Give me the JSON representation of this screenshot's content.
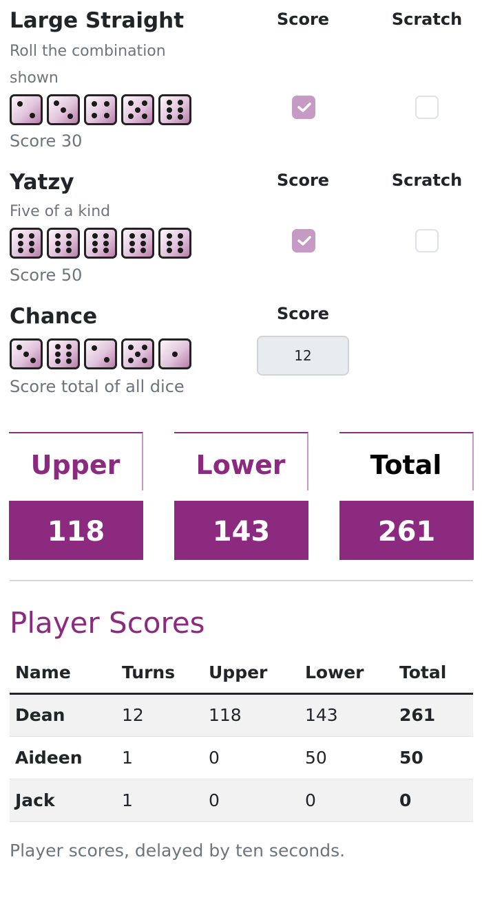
{
  "categories": [
    {
      "title": "Large Straight",
      "description": "Roll the combination shown",
      "dice": [
        2,
        3,
        4,
        5,
        6
      ],
      "score_line": "Score 30",
      "score_header": "Score",
      "scratch_header": "Scratch",
      "score_checked": true,
      "scratch_checked": false
    },
    {
      "title": "Yatzy",
      "description": "Five of a kind",
      "dice": [
        6,
        6,
        6,
        6,
        6
      ],
      "score_line": "Score 50",
      "score_header": "Score",
      "scratch_header": "Scratch",
      "score_checked": true,
      "scratch_checked": false
    },
    {
      "title": "Chance",
      "description": "Score total of all dice",
      "dice": [
        3,
        6,
        2,
        5,
        1
      ],
      "score_header": "Score",
      "score_value": "12"
    }
  ],
  "totals": [
    {
      "label": "Upper",
      "value": "118",
      "color": "#8b2a7e"
    },
    {
      "label": "Lower",
      "value": "143",
      "color": "#8b2a7e"
    },
    {
      "label": "Total",
      "value": "261",
      "color": "#000000"
    }
  ],
  "player_scores": {
    "title": "Player Scores",
    "columns": [
      "Name",
      "Turns",
      "Upper",
      "Lower",
      "Total"
    ],
    "rows": [
      [
        "Dean",
        "12",
        "118",
        "143",
        "261"
      ],
      [
        "Aideen",
        "1",
        "0",
        "50",
        "50"
      ],
      [
        "Jack",
        "1",
        "0",
        "0",
        "0"
      ]
    ],
    "footnote": "Player scores, delayed by ten seconds."
  },
  "colors": {
    "accent": "#8b2a7e",
    "checkbox_checked": "#c59ac4"
  }
}
